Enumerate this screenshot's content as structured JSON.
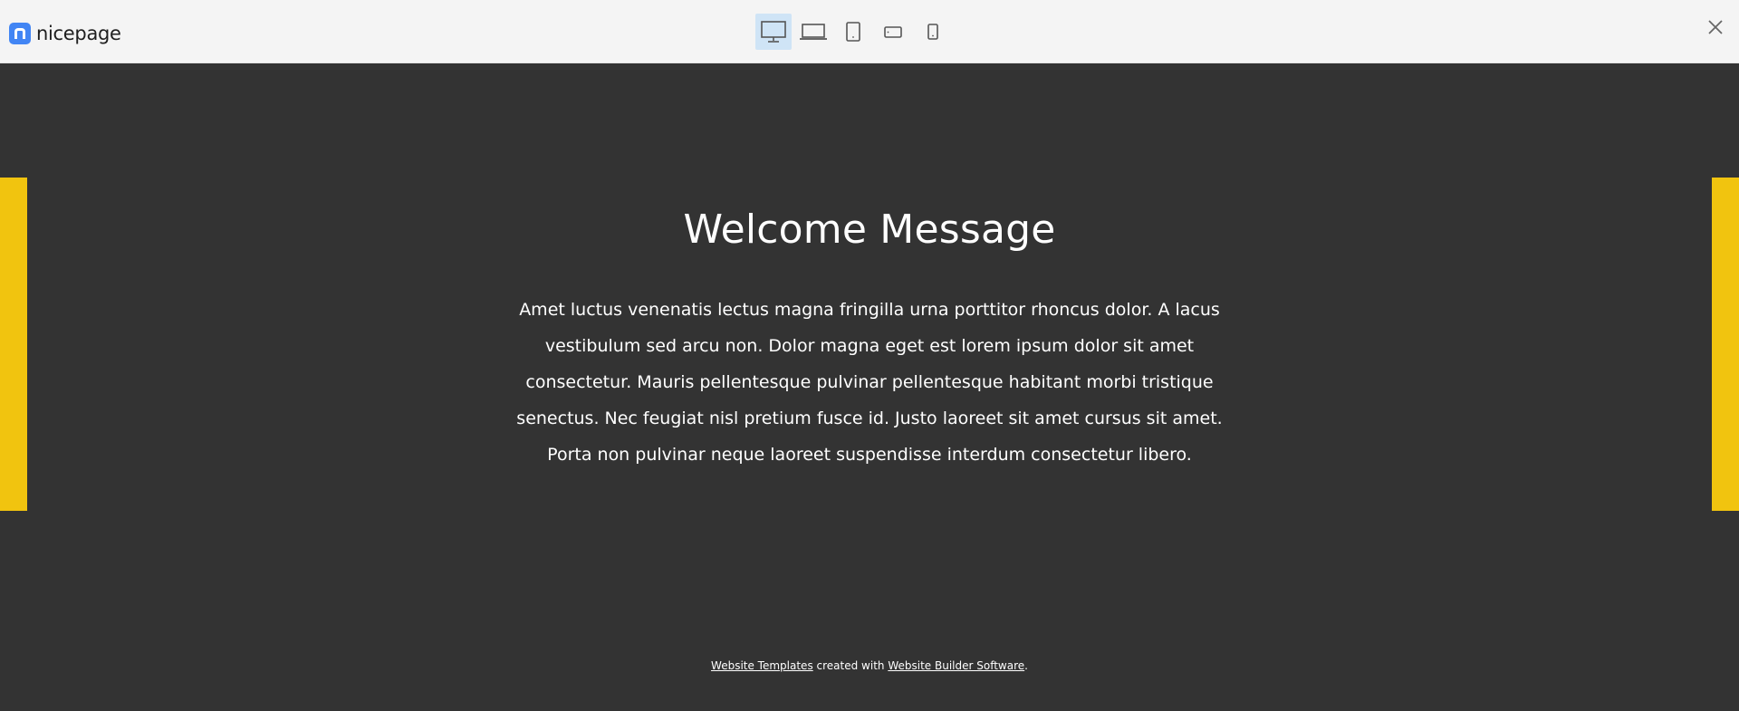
{
  "app": {
    "brand": "nicepage"
  },
  "toolbar": {
    "devices": [
      {
        "icon": "desktop-icon",
        "active": true
      },
      {
        "icon": "laptop-icon",
        "active": false
      },
      {
        "icon": "tablet-icon",
        "active": false
      },
      {
        "icon": "phone-landscape-icon",
        "active": false
      },
      {
        "icon": "phone-portrait-icon",
        "active": false
      }
    ],
    "close_icon": "close-icon"
  },
  "content": {
    "heading": "Welcome Message",
    "body": "Amet luctus venenatis lectus magna fringilla urna porttitor rhoncus dolor. A lacus vestibulum sed arcu non. Dolor magna eget est lorem ipsum dolor sit amet consectetur. Mauris pellentesque pulvinar pellentesque habitant morbi tristique senectus. Nec feugiat nisl pretium fusce id. Justo laoreet sit amet cursus sit amet. Porta non pulvinar neque laoreet suspendisse interdum consectetur libero."
  },
  "footer": {
    "link1": "Website Templates",
    "middle": " created with ",
    "link2": "Website Builder Software",
    "end": "."
  },
  "colors": {
    "background": "#333333",
    "accent": "#f1c40f",
    "topbar": "#f4f4f4",
    "active_device": "#cfe4f6",
    "brand_blue": "#4285f4"
  }
}
